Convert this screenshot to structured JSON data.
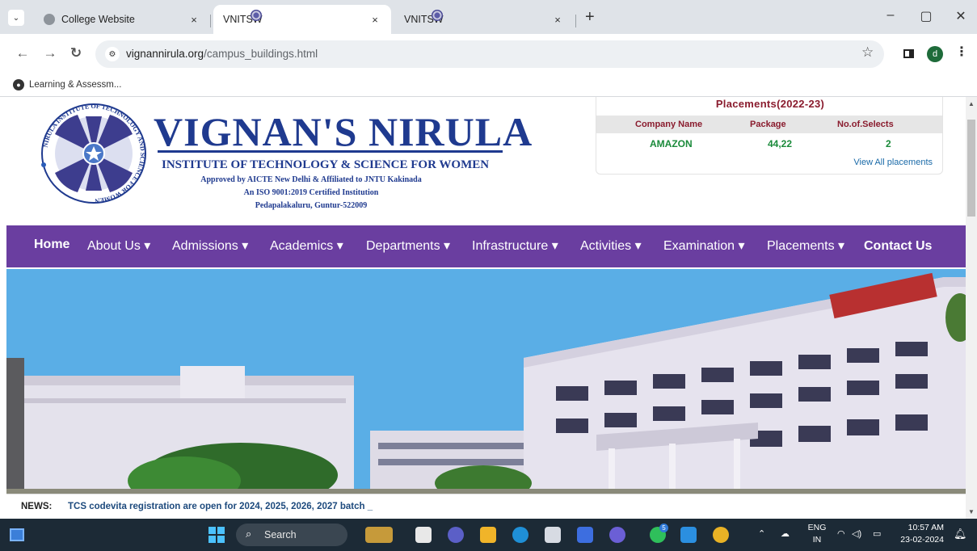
{
  "browser": {
    "tabs": [
      {
        "title": "College Website",
        "active": false
      },
      {
        "title": "VNITSW",
        "active": true
      },
      {
        "title": "VNITSW",
        "active": false
      }
    ],
    "tab_close": "×",
    "new_tab": "+",
    "url_domain": "vignannirula.org",
    "url_path": "/campus_buildings.html",
    "bookmark": "Learning & Assessm...",
    "avatar_letter": "d",
    "window_minimize": "–",
    "window_restore": "▢",
    "window_close": "✕"
  },
  "site": {
    "title": "VIGNAN'S NIRULA",
    "subtitle": "INSTITUTE OF TECHNOLOGY & SCIENCE FOR WOMEN",
    "approval": "Approved by AICTE New Delhi & Affiliated to JNTU Kakinada",
    "iso": "An ISO 9001:2019 Certified Institution",
    "address": "Pedapalakaluru, Guntur-522009",
    "logo_ring_text": "NIRULA INSTITUTE OF TECHNOLOGY AND SCIENCE FOR WOMEN"
  },
  "placements": {
    "title": "Placements(2022-23)",
    "headers": [
      "Company Name",
      "Package",
      "No.of.Selects"
    ],
    "rows": [
      [
        "AMAZON",
        "44,22",
        "2"
      ]
    ],
    "link": "View All placements"
  },
  "nav": {
    "items": [
      "Home",
      "About Us ▾",
      "Admissions ▾",
      "Academics ▾",
      "Departments ▾",
      "Infrastructure ▾",
      "Activities ▾",
      "Examination ▾",
      "Placements ▾",
      "Contact Us"
    ]
  },
  "news": {
    "label": "NEWS:",
    "text": "TCS codevita registration are open for 2024, 2025, 2026, 2027 batch _"
  },
  "taskbar": {
    "search_placeholder": "Search",
    "badge_count": "5",
    "lang_line1": "ENG",
    "lang_line2": "IN",
    "time": "10:57 AM",
    "date": "23-02-2024"
  },
  "colors": {
    "nav_bg": "#6a3ea0",
    "brand_blue": "#1f3a8f",
    "placement_red": "#8a1c2e",
    "placement_green": "#1a8a3a",
    "taskbar_bg": "#1c2a36"
  }
}
